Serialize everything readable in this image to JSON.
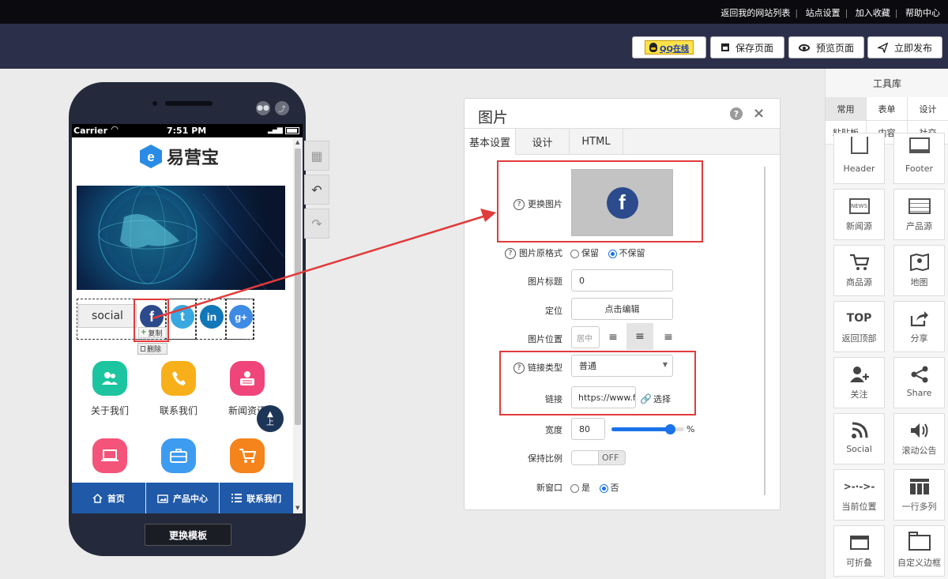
{
  "topbar": {
    "links": [
      "返回我的网站列表",
      "站点设置",
      "加入收藏",
      "帮助中心"
    ]
  },
  "actionbar": {
    "qq_label": "QQ在线",
    "save_label": "保存页面",
    "preview_label": "预览页面",
    "publish_label": "立即发布"
  },
  "phone": {
    "carrier": "Carrier",
    "time": "7:51 PM",
    "logo_text": "易营宝",
    "social_label": "social",
    "copy_label": "复制",
    "delete_label": "删除",
    "apps": [
      {
        "label": "关于我们",
        "color": "#1cc5a0",
        "icon": "people-icon"
      },
      {
        "label": "联系我们",
        "color": "#f8b01a",
        "icon": "phone-icon"
      },
      {
        "label": "新闻资讯",
        "color": "#f0457a",
        "icon": "news-icon"
      },
      {
        "label": "",
        "color": "#f5547a",
        "icon": "laptop-icon"
      },
      {
        "label": "",
        "color": "#3e9cf0",
        "icon": "briefcase-icon"
      },
      {
        "label": "",
        "color": "#f5841c",
        "icon": "cart-icon"
      }
    ],
    "back_top_label": "上",
    "nav": [
      "首页",
      "产品中心",
      "联系我们"
    ],
    "template_btn": "更换模板"
  },
  "panel": {
    "title": "图片",
    "tabs": [
      "基本设置",
      "设计",
      "HTML"
    ],
    "fields": {
      "replace_image": "更换图片",
      "keep_format": "图片原格式",
      "keep_opt": "保留",
      "nokeep_opt": "不保留",
      "img_title": "图片标题",
      "img_title_value": "0",
      "position": "定位",
      "position_btn": "点击编辑",
      "img_pos": "图片位置",
      "img_pos_value": "居中",
      "link_type": "链接类型",
      "link_type_value": "普通",
      "link": "链接",
      "link_value": "https://www.fa",
      "choose": "选择",
      "width": "宽度",
      "width_value": "80",
      "width_percent": 80,
      "percent_sign": "%",
      "keep_ratio": "保持比例",
      "toggle_off": "OFF",
      "new_window": "新窗口",
      "yes": "是",
      "no": "否"
    }
  },
  "toolbox": {
    "title": "工具库",
    "tabs_row1": [
      "常用",
      "表单",
      "设计"
    ],
    "tabs_row2": [
      "粘贴板",
      "内容",
      "社交"
    ],
    "tools": [
      "Header",
      "Footer",
      "新闻源",
      "产品源",
      "商品源",
      "地图",
      "返回顶部",
      "分享",
      "关注",
      "Share",
      "Social",
      "滚动公告",
      "当前位置",
      "一行多列",
      "可折叠",
      "自定义边框"
    ]
  },
  "colors": {
    "topbar": "#0b0b0f",
    "actionbar": "#2c2f4a",
    "accent_red": "#e23b3b",
    "nav_blue": "#1f59a8"
  }
}
